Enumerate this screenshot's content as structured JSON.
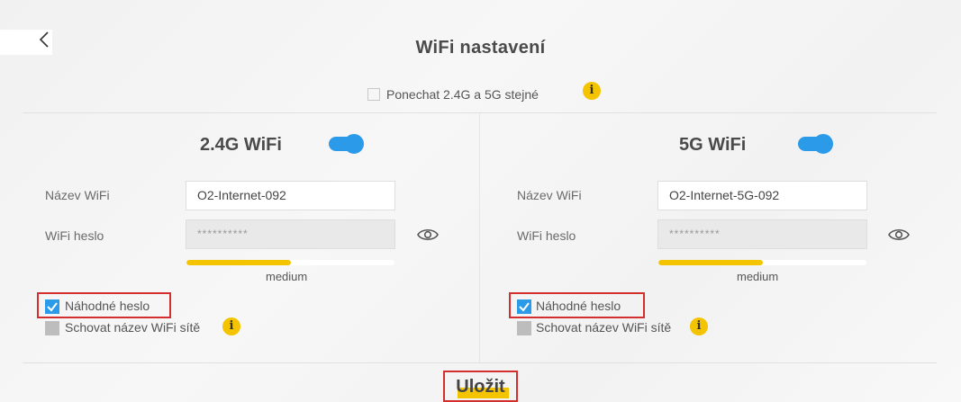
{
  "header": {
    "title": "WiFi nastavení",
    "back_icon": "chevron-left-icon"
  },
  "sync": {
    "label": "Ponechat 2.4G a 5G stejné",
    "checked": false
  },
  "bands": [
    {
      "title": "2.4G WiFi",
      "enabled": true,
      "ssid_label": "Název WiFi",
      "ssid_value": "O2-Internet-092",
      "password_label": "WiFi heslo",
      "password_value": "**********",
      "strength_text": "medium",
      "strength_level": 0.5,
      "random_password_label": "Náhodné heslo",
      "random_password_checked": true,
      "hide_ssid_label": "Schovat název WiFi sítě",
      "hide_ssid_checked": false
    },
    {
      "title": "5G WiFi",
      "enabled": true,
      "ssid_label": "Název WiFi",
      "ssid_value": "O2-Internet-5G-092",
      "password_label": "WiFi heslo",
      "password_value": "**********",
      "strength_text": "medium",
      "strength_level": 0.5,
      "random_password_label": "Náhodné heslo",
      "random_password_checked": true,
      "hide_ssid_label": "Schovat název WiFi sítě",
      "hide_ssid_checked": false
    }
  ],
  "actions": {
    "save_label": "Uložit"
  },
  "colors": {
    "accent": "#2b9be9",
    "highlight": "#f5c400",
    "annotation": "#d32f2f"
  }
}
